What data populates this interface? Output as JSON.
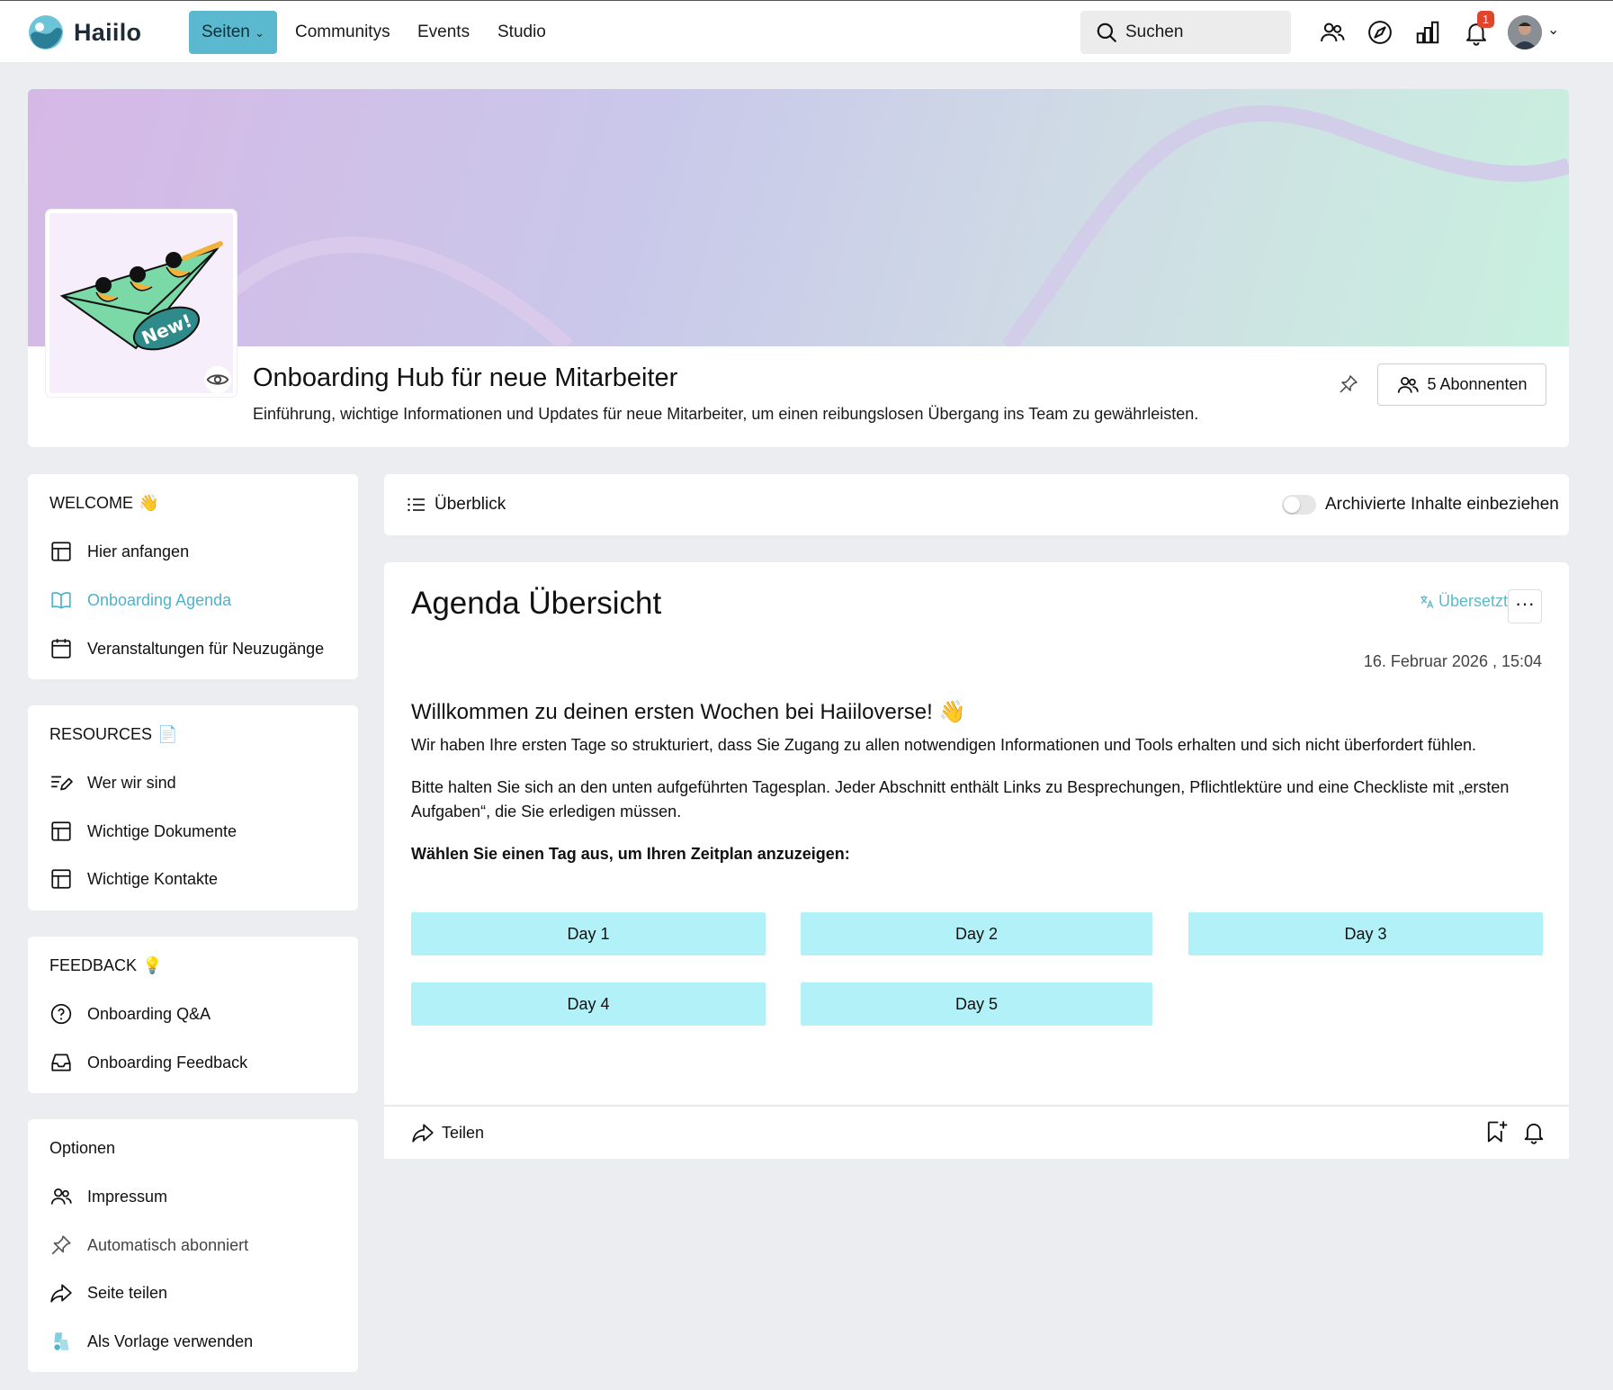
{
  "topbar": {
    "logo_text": "Haiilo",
    "nav": [
      {
        "label": "Seiten",
        "active": true
      },
      {
        "label": "Communitys"
      },
      {
        "label": "Events"
      },
      {
        "label": "Studio"
      }
    ],
    "search_label": "Suchen",
    "icons": [
      "people-icon",
      "compass-icon",
      "chart-icon",
      "bell-icon"
    ],
    "notification_count": "1"
  },
  "header": {
    "title": "Onboarding Hub für neue Mitarbeiter",
    "description": "Einführung, wichtige Informationen und Updates für neue Mitarbeiter, um einen reibungslosen Übergang ins Team zu gewährleisten.",
    "subscribers_label": "5 Abonnenten",
    "thumbnail_badge": "New!"
  },
  "sidebar": {
    "welcome": {
      "heading": "WELCOME",
      "emoji": "👋",
      "items": [
        {
          "label": "Hier anfangen",
          "icon": "table-icon"
        },
        {
          "label": "Onboarding Agenda",
          "icon": "book-icon",
          "active": true
        },
        {
          "label": "Veranstaltungen für Neuzugänge",
          "icon": "calendar-icon"
        }
      ]
    },
    "resources": {
      "heading": "RESOURCES",
      "emoji": "📄",
      "items": [
        {
          "label": "Wer wir sind",
          "icon": "edit-list-icon"
        },
        {
          "label": "Wichtige Dokumente",
          "icon": "table-icon"
        },
        {
          "label": "Wichtige Kontakte",
          "icon": "table-icon"
        }
      ]
    },
    "feedback": {
      "heading": "FEEDBACK",
      "emoji": "💡",
      "items": [
        {
          "label": "Onboarding Q&A",
          "icon": "question-icon"
        },
        {
          "label": "Onboarding Feedback",
          "icon": "inbox-icon"
        }
      ]
    },
    "options": {
      "heading": "Optionen",
      "items": [
        {
          "label": "Impressum",
          "icon": "people-icon"
        },
        {
          "label": "Automatisch abonniert",
          "icon": "pin-icon"
        },
        {
          "label": "Seite teilen",
          "icon": "share-icon"
        },
        {
          "label": "Als Vorlage verwenden",
          "icon": "template-icon"
        }
      ]
    }
  },
  "overview": {
    "label": "Überblick",
    "toggle_label": "Archivierte Inhalte einbeziehen",
    "toggle_on": false
  },
  "content": {
    "title": "Agenda Übersicht",
    "translated_label": "Übersetzt",
    "more_label": "···",
    "date": "16. Februar 2026 , 15:04",
    "welcome_heading": "Willkommen zu deinen ersten Wochen bei Haiiloverse!",
    "welcome_emoji": "👋",
    "para1": "Wir haben Ihre ersten Tage so strukturiert, dass Sie Zugang zu allen notwendigen Informationen und Tools erhalten und sich nicht überfordert fühlen.",
    "para2": "Bitte halten Sie sich an den unten aufgeführten Tagesplan. Jeder Abschnitt enthält Links zu Besprechungen, Pflichtlektüre und eine Checkliste mit „ersten Aufgaben“, die Sie erledigen müssen.",
    "para3": "Wählen Sie einen Tag aus, um Ihren Zeitplan anzuzeigen:",
    "days": [
      "Day 1",
      "Day 2",
      "Day 3",
      "Day 4",
      "Day 5"
    ],
    "footer": {
      "share_label": "Teilen"
    }
  },
  "colors": {
    "accent": "#5ab9cf",
    "day_button": "#b3f1f9",
    "badge": "#e0442c"
  }
}
